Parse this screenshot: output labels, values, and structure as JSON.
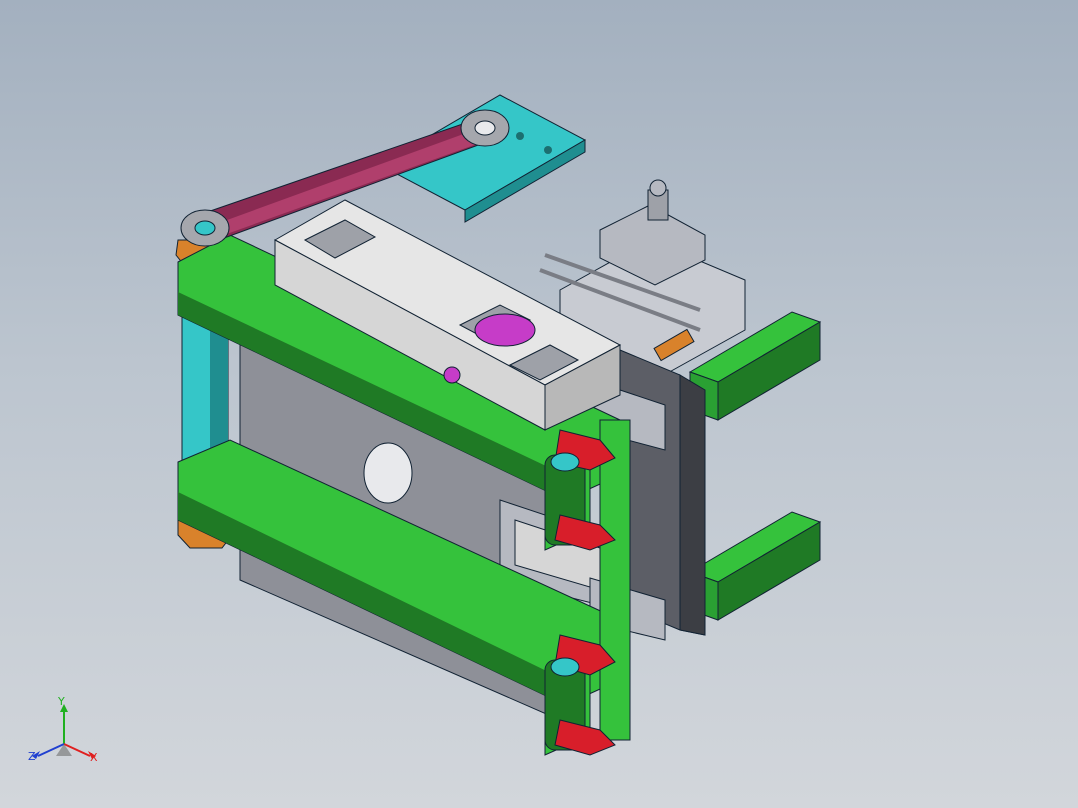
{
  "viewport": {
    "background_top": "#a3b0bf",
    "background_bottom": "#d2d6db"
  },
  "triad": {
    "x_label": "X",
    "y_label": "Y",
    "z_label": "Z",
    "x_color": "#e02020",
    "y_color": "#20b020",
    "z_color": "#2040d0"
  },
  "model": {
    "colors": {
      "green": "#35c23c",
      "dark_green": "#1f7a25",
      "light_gray": "#d6d6d6",
      "gray": "#8e9098",
      "dark_gray": "#5c5e66",
      "cyan": "#35c6c8",
      "magenta": "#c63cc8",
      "maroon": "#8a2a52",
      "red": "#d81e2a",
      "orange": "#d9822b"
    }
  }
}
